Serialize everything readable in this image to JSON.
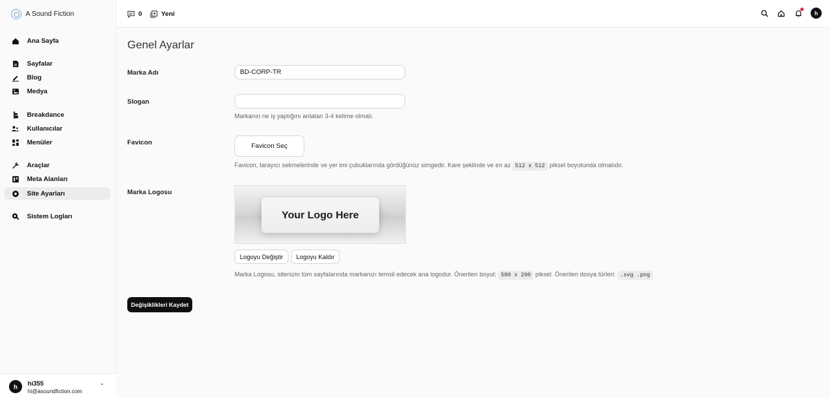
{
  "sidebar": {
    "brand": "A Sound Fiction",
    "items": [
      {
        "label": "Ana Sayfa",
        "icon": "home-icon"
      },
      {
        "label": "Sayfalar",
        "icon": "page-icon"
      },
      {
        "label": "Blog",
        "icon": "pencil-icon"
      },
      {
        "label": "Medya",
        "icon": "image-icon"
      },
      {
        "label": "Breakdance",
        "icon": "breakdance-icon"
      },
      {
        "label": "Kullanıcılar",
        "icon": "users-icon"
      },
      {
        "label": "Menüler",
        "icon": "grid-icon"
      },
      {
        "label": "Araçlar",
        "icon": "wrench-icon"
      },
      {
        "label": "Meta Alanları",
        "icon": "meta-icon"
      },
      {
        "label": "Site Ayarları",
        "icon": "settings-icon",
        "active": true
      },
      {
        "label": "Sistem Logları",
        "icon": "log-search-icon"
      }
    ],
    "user": {
      "initial": "h",
      "name": "hi355",
      "email": "hi@asoundfiction.com"
    }
  },
  "topbar": {
    "comments_count": "0",
    "new_label": "Yeni",
    "avatar_initial": "h"
  },
  "main": {
    "title": "Genel Ayarlar",
    "brand_name": {
      "label": "Marka Adı",
      "value": "BD-CORP-TR"
    },
    "slogan": {
      "label": "Slogan",
      "value": "",
      "help": "Markanın ne iş yaptığını anlatan 3-4 kelime olmalı."
    },
    "favicon": {
      "label": "Favicon",
      "button": "Favicon Seç",
      "help_before": "Favicon, tarayıcı sekmelerinde ve yer imi çubuklarında gördüğünüz simgedir. Kare şeklinde ve en az",
      "help_code": "512 x 512",
      "help_after": "piksel boyutunda olmalıdır."
    },
    "logo": {
      "label": "Marka Logosu",
      "preview_text": "Your Logo Here",
      "change_button": "Logoyu Değiştir",
      "remove_button": "Logoyu Kaldır",
      "help_before": "Marka Logosu, sitenizin tüm sayfalarında markanızı temsil edecek ana logodur. Önerilen boyut:",
      "help_code1": "500 x 200",
      "help_middle": "piksel. Önerilen dosya türleri:",
      "help_code2": ".svg .png"
    },
    "save_button": "Değişiklikleri Kaydet"
  },
  "colors": {
    "accent": "#0f0f0f",
    "notification": "#e0284a",
    "brand_ring": "#7aa7d6"
  }
}
